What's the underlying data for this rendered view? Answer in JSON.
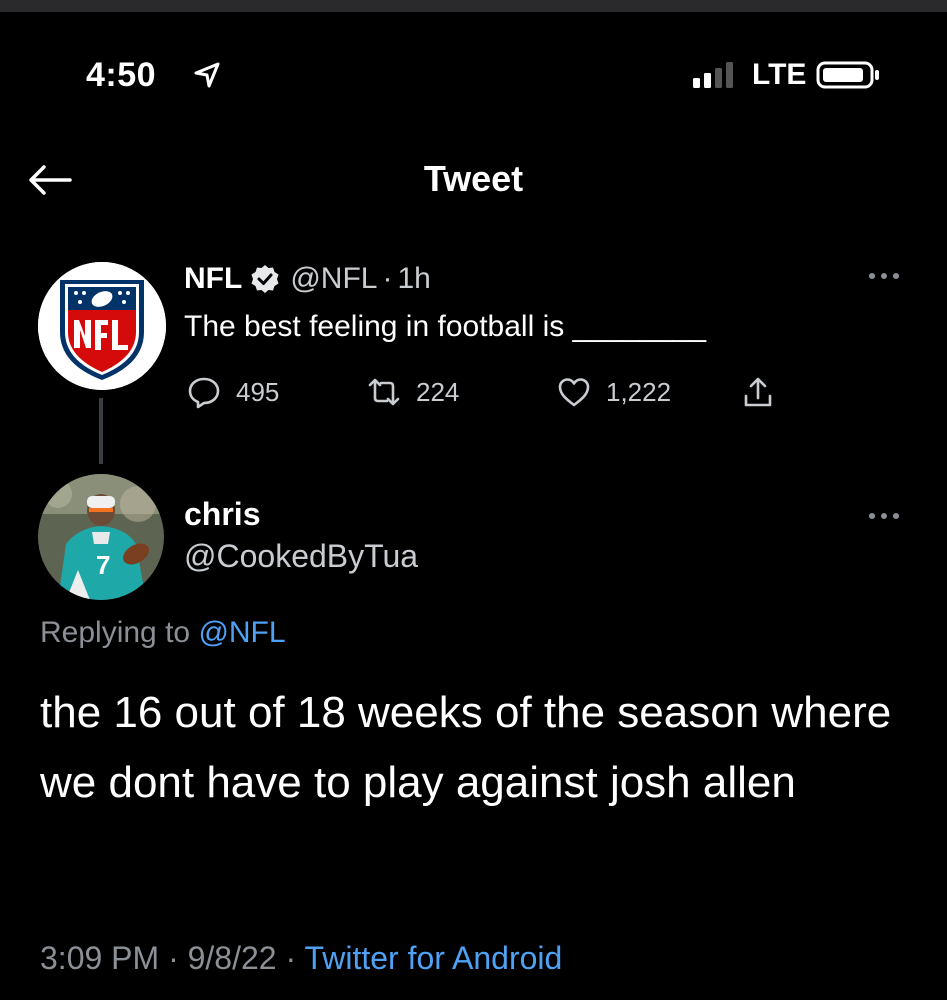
{
  "status_bar": {
    "time": "4:50",
    "network": "LTE",
    "icons": [
      "location-arrow-icon",
      "signal-icon",
      "battery-icon"
    ]
  },
  "header": {
    "title": "Tweet",
    "back_icon": "back-arrow-icon"
  },
  "original_tweet": {
    "author_name": "NFL",
    "verified": true,
    "handle": "@NFL",
    "separator": "·",
    "age": "1h",
    "text": "The best feeling in football is ________",
    "actions": {
      "replies": "495",
      "retweets": "224",
      "likes": "1,222"
    }
  },
  "reply_tweet": {
    "author_name": "chris",
    "handle": "@CookedByTua",
    "replying_prefix": "Replying to",
    "replying_to": "@NFL",
    "text": "the 16 out of 18 weeks of the season where we dont have to play against josh allen",
    "time": "3:09 PM",
    "date": "9/8/22",
    "client": "Twitter for Android"
  },
  "colors": {
    "background": "#000000",
    "link": "#4ea1f3",
    "secondary_text": "#8b9096",
    "nfl_blue": "#013369",
    "nfl_red": "#d50a0a",
    "dolphins_aqua": "#1fa8a8"
  }
}
